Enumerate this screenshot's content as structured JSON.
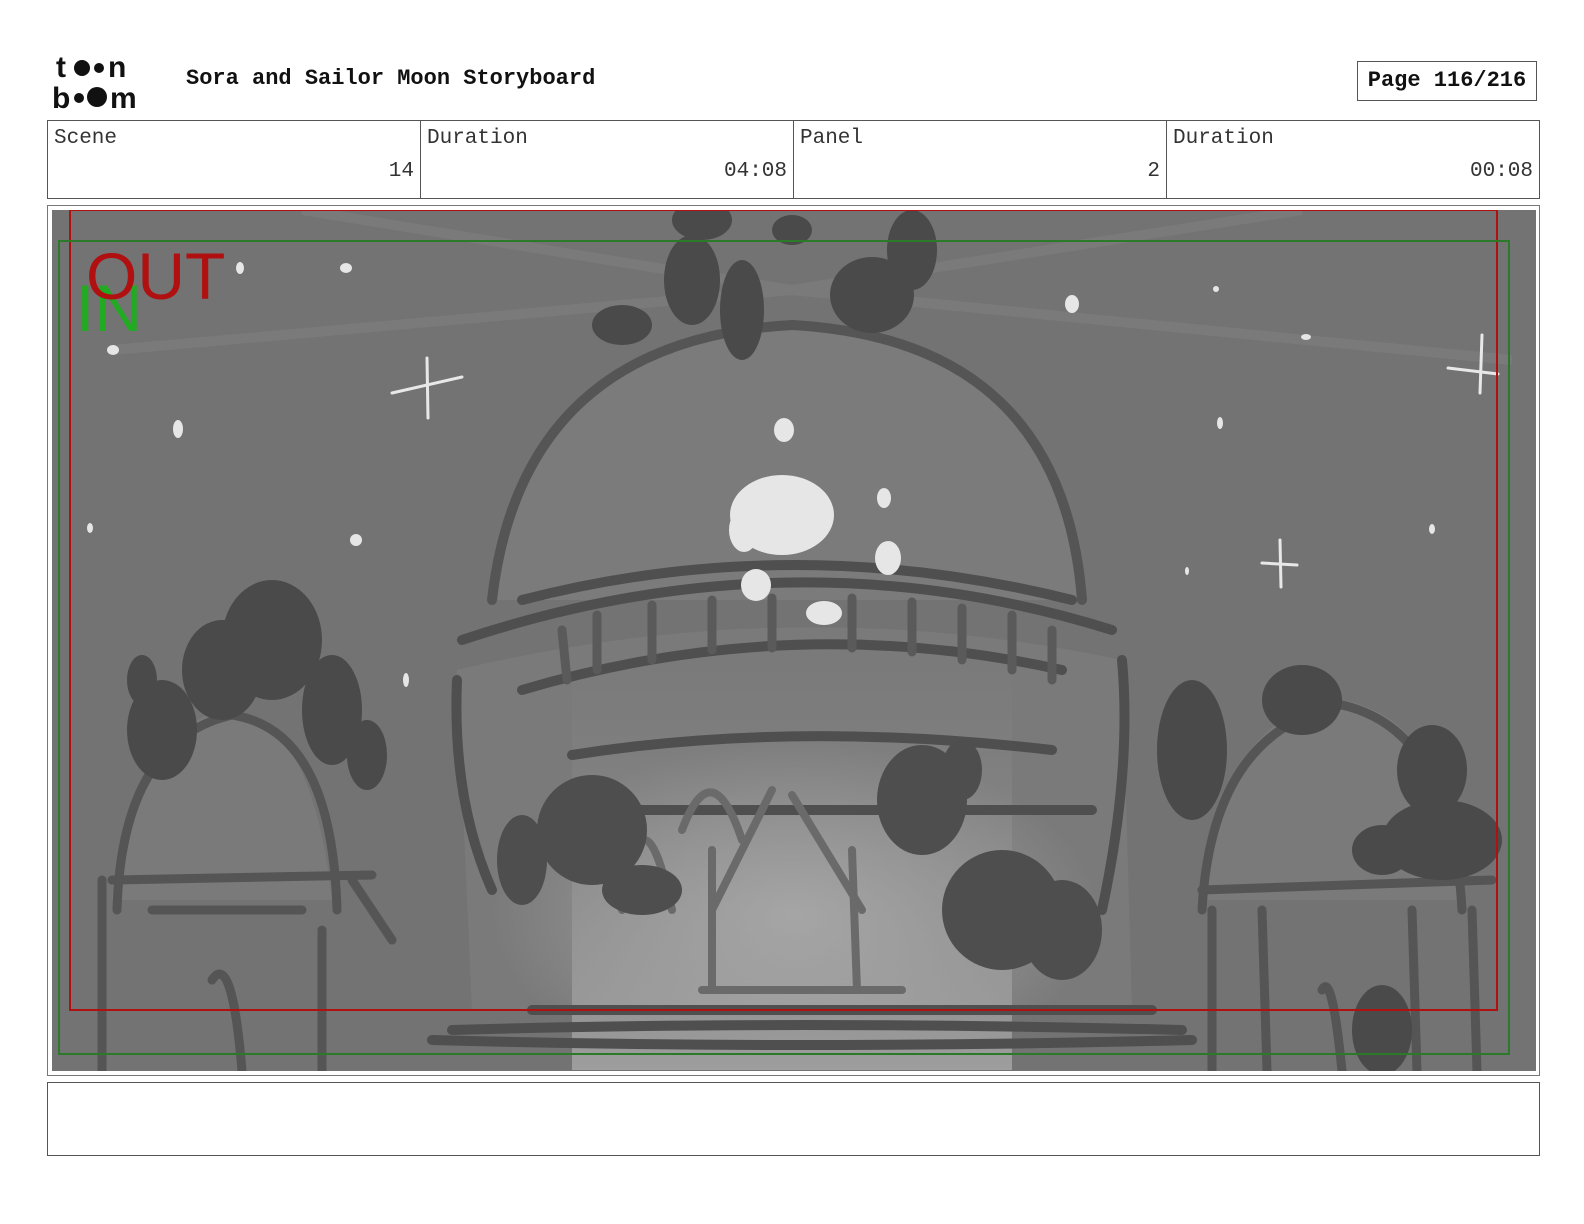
{
  "header": {
    "title": "Sora and Sailor Moon Storyboard",
    "page": "Page 116/216"
  },
  "logo": {
    "text": "toon boom"
  },
  "info": [
    {
      "label": "Scene",
      "value": "14"
    },
    {
      "label": "Duration",
      "value": "04:08"
    },
    {
      "label": "Panel",
      "value": "2"
    },
    {
      "label": "Duration",
      "value": "00:08"
    }
  ],
  "panel": {
    "in_label": "IN",
    "out_label": "OUT",
    "colors": {
      "in_frame": "#2a7a2a",
      "out_frame": "#b01010",
      "sky": "#707070",
      "silhouette": "#4a4a4a"
    }
  },
  "notes": {
    "text": ""
  }
}
